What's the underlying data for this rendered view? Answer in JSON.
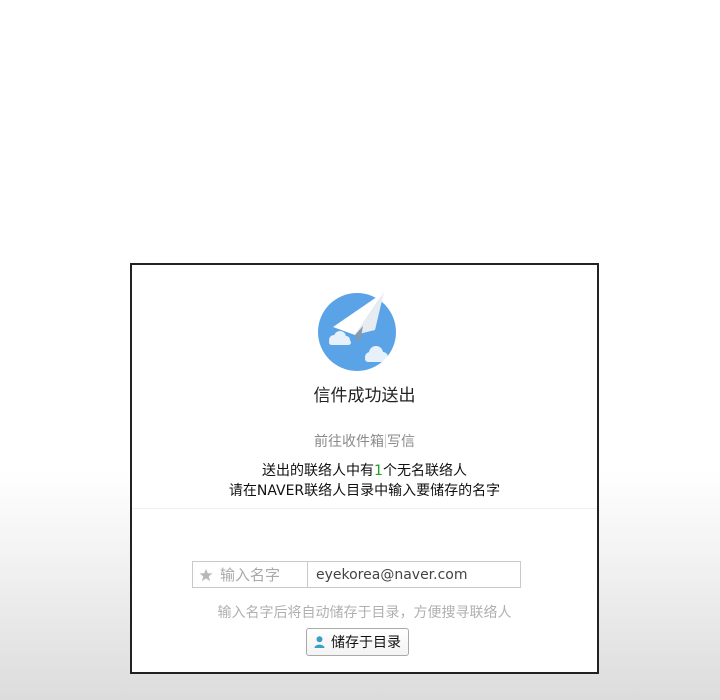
{
  "dialog": {
    "title": "信件成功送出",
    "links": {
      "inbox": "前往收件箱",
      "compose": "写信"
    },
    "message": {
      "line1_prefix": "送出的联络人中有",
      "count": "1",
      "line1_suffix": "个无名联络人",
      "line2": "请在NAVER联络人目录中输入要储存的名字"
    },
    "form": {
      "name_placeholder": "输入名字",
      "email": "eyekorea@naver.com"
    },
    "hint": "输入名字后将自动储存于目录，方便搜寻联络人",
    "save_button": "储存于目录"
  },
  "colors": {
    "plane_circle": "#5aa3e6",
    "count_highlight": "#1aa025",
    "person_icon": "#3a9fc8"
  },
  "icons": [
    "paper-plane-icon",
    "star-icon",
    "person-icon"
  ]
}
